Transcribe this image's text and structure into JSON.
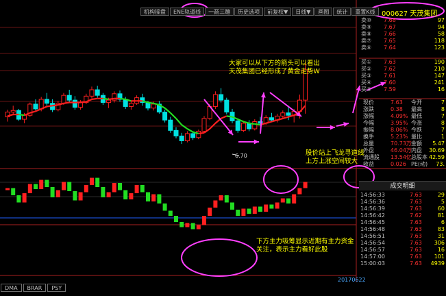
{
  "toolbar": [
    "机构操盘",
    "ENE轨道线",
    "一箭三雕",
    "历史选项",
    "前复权▼",
    "日线▼",
    "画图",
    "统计",
    "重置K线"
  ],
  "stock_title": "000627  天茂集团",
  "sell_rows": [
    [
      "卖⑩",
      "7.68",
      "97"
    ],
    [
      "卖⑨",
      "7.67",
      "94"
    ],
    [
      "卖⑧",
      "7.66",
      "58"
    ],
    [
      "卖⑦",
      "7.65",
      "118"
    ],
    [
      "卖⑥",
      "7.64",
      "123"
    ]
  ],
  "buy_rows": [
    [
      "买①",
      "7.63",
      "190"
    ],
    [
      "买②",
      "7.62",
      "210"
    ],
    [
      "买③",
      "7.61",
      "147"
    ],
    [
      "买④",
      "7.60",
      "241"
    ],
    [
      "买⑤",
      "7.59",
      "16"
    ]
  ],
  "quote_rows": [
    [
      "现价",
      "7.63",
      "今开",
      "7"
    ],
    [
      "涨跌",
      "0.38",
      "最高",
      "8"
    ],
    [
      "涨幅",
      "4.09%",
      "最低",
      "7"
    ],
    [
      "今幅",
      "3.95%",
      "今涨",
      "8"
    ],
    [
      "振幅",
      "8.06%",
      "今跌",
      "7"
    ],
    [
      "换手",
      "5.23%",
      "量比",
      "1"
    ],
    [
      "总量",
      "70.73万",
      "金额",
      "5.47"
    ],
    [
      "外盘",
      "46.04万",
      "内盘",
      "30.69"
    ],
    [
      "流通股",
      "13.54亿",
      "总股本",
      "42.59"
    ],
    [
      "收益",
      "0.026",
      "PE(动)",
      "73."
    ]
  ],
  "trade_title": "成交明细",
  "trades": [
    [
      "14:56:33",
      "7.63",
      "29"
    ],
    [
      "14:56:36",
      "7.63",
      "5"
    ],
    [
      "14:56:39",
      "7.63",
      "60"
    ],
    [
      "14:56:42",
      "7.62",
      "81"
    ],
    [
      "14:56:45",
      "7.63",
      "6"
    ],
    [
      "14:56:48",
      "7.63",
      "83"
    ],
    [
      "14:56:51",
      "7.63",
      "31"
    ],
    [
      "14:56:54",
      "7.63",
      "306"
    ],
    [
      "14:56:57",
      "7.63",
      "16"
    ],
    [
      "14:57:00",
      "7.63",
      "101"
    ],
    [
      "15:00:03",
      "7.63",
      "4939"
    ]
  ],
  "annotations": {
    "a1": [
      "大家可以从下方的箭头可以看出",
      "天茂集团已经形成了黄金走势W"
    ],
    "a2": [
      "股价站上飞龙寻道线",
      "上方上涨空间较大"
    ],
    "a3": [
      "下方主力吸筹显示近期有主力资金",
      "关注，表示主力看好此股"
    ]
  },
  "low_label": "6.70",
  "date_label": "20170622",
  "bottom_tabs": [
    "DMA",
    "BRAR",
    "PSY"
  ],
  "colors": {
    "up": "#ff2020",
    "down": "#00e0e0",
    "ma_up": "#ff2020",
    "ma_down": "#22dd22",
    "osc_up": "#ff2020",
    "osc_down": "#22dd22",
    "vol": "#d060f0",
    "arrow": "#ff40ff",
    "circle": "#ff40ff",
    "gridline": "#8a1a1a",
    "text_yellow": "#ffff00"
  },
  "chart_data": {
    "type": "candlestick",
    "ylim": [
      6.4,
      8.3
    ],
    "candles": [
      [
        7.04,
        7.13,
        6.98,
        7.1
      ],
      [
        7.1,
        7.18,
        7.06,
        7.12
      ],
      [
        7.12,
        7.14,
        6.99,
        7.01
      ],
      [
        7.01,
        7.09,
        6.96,
        7.06
      ],
      [
        7.06,
        7.22,
        7.04,
        7.2
      ],
      [
        7.2,
        7.26,
        7.12,
        7.14
      ],
      [
        7.14,
        7.29,
        7.11,
        7.26
      ],
      [
        7.26,
        7.34,
        7.18,
        7.21
      ],
      [
        7.21,
        7.26,
        7.1,
        7.13
      ],
      [
        7.13,
        7.24,
        7.11,
        7.21
      ],
      [
        7.21,
        7.34,
        7.19,
        7.31
      ],
      [
        7.31,
        7.38,
        7.22,
        7.25
      ],
      [
        7.25,
        7.3,
        7.13,
        7.16
      ],
      [
        7.16,
        7.25,
        7.13,
        7.22
      ],
      [
        7.22,
        7.33,
        7.2,
        7.3
      ],
      [
        7.3,
        7.42,
        7.27,
        7.38
      ],
      [
        7.38,
        7.43,
        7.28,
        7.31
      ],
      [
        7.31,
        7.34,
        7.19,
        7.22
      ],
      [
        7.22,
        7.28,
        7.15,
        7.25
      ],
      [
        7.25,
        7.36,
        7.22,
        7.33
      ],
      [
        7.33,
        7.37,
        7.23,
        7.26
      ],
      [
        7.26,
        7.29,
        7.14,
        7.17
      ],
      [
        7.17,
        7.24,
        7.13,
        7.21
      ],
      [
        7.21,
        7.31,
        7.19,
        7.28
      ],
      [
        7.28,
        7.33,
        7.18,
        7.22
      ],
      [
        7.22,
        7.24,
        7.12,
        7.15
      ],
      [
        7.15,
        7.23,
        7.12,
        7.2
      ],
      [
        7.2,
        7.24,
        7.08,
        7.1
      ],
      [
        7.1,
        7.13,
        6.97,
        7.0
      ],
      [
        7.0,
        7.04,
        6.84,
        6.87
      ],
      [
        6.87,
        6.91,
        6.77,
        6.8
      ],
      [
        6.8,
        6.84,
        6.7,
        6.74
      ],
      [
        6.74,
        6.86,
        6.72,
        6.83
      ],
      [
        6.83,
        6.86,
        6.75,
        6.78
      ],
      [
        6.78,
        6.88,
        6.76,
        6.86
      ],
      [
        6.86,
        7.05,
        6.84,
        7.02
      ],
      [
        7.02,
        7.2,
        7.0,
        7.17
      ],
      [
        7.17,
        7.36,
        7.14,
        7.32
      ],
      [
        7.32,
        7.4,
        7.22,
        7.25
      ],
      [
        7.25,
        7.28,
        7.07,
        7.1
      ],
      [
        7.1,
        7.14,
        6.96,
        6.99
      ],
      [
        6.99,
        7.02,
        6.84,
        6.87
      ],
      [
        6.87,
        6.99,
        6.85,
        6.96
      ],
      [
        6.96,
        7.0,
        6.86,
        6.89
      ],
      [
        6.89,
        7.01,
        6.87,
        6.98
      ],
      [
        6.98,
        7.04,
        6.93,
        6.96
      ],
      [
        6.96,
        7.06,
        6.94,
        7.03
      ],
      [
        7.03,
        7.09,
        6.98,
        7.0
      ],
      [
        7.0,
        7.08,
        6.97,
        7.05
      ],
      [
        7.05,
        7.12,
        7.02,
        7.09
      ],
      [
        7.09,
        7.18,
        7.0,
        7.06
      ],
      [
        7.06,
        7.14,
        6.97,
        7.11
      ],
      [
        7.11,
        7.32,
        7.02,
        7.25
      ],
      [
        7.25,
        7.73,
        7.08,
        7.63
      ]
    ],
    "ma": [
      7.05,
      7.07,
      7.07,
      7.06,
      7.09,
      7.11,
      7.14,
      7.17,
      7.18,
      7.19,
      7.21,
      7.22,
      7.22,
      7.22,
      7.23,
      7.26,
      7.27,
      7.27,
      7.26,
      7.27,
      7.27,
      7.26,
      7.24,
      7.24,
      7.24,
      7.22,
      7.21,
      7.19,
      7.15,
      7.09,
      7.02,
      6.94,
      6.89,
      6.85,
      6.83,
      6.84,
      6.89,
      6.96,
      7.02,
      7.05,
      7.04,
      7.01,
      6.98,
      6.96,
      6.95,
      6.94,
      6.96,
      6.98,
      7.0,
      7.02,
      7.04,
      7.06,
      7.1,
      7.18
    ],
    "osc": [
      58,
      44,
      30,
      48,
      66,
      56,
      74,
      60,
      40,
      54,
      70,
      52,
      34,
      50,
      64,
      78,
      60,
      40,
      50,
      68,
      54,
      36,
      48,
      64,
      50,
      32,
      46,
      28,
      14,
      4,
      -8,
      -18,
      -10,
      -22,
      -14,
      4,
      20,
      34,
      44,
      30,
      16,
      4,
      18,
      8,
      22,
      12,
      26,
      18,
      30,
      38,
      28,
      46,
      58,
      70
    ],
    "volume": [
      0,
      0,
      0,
      0,
      0,
      0,
      0,
      0,
      0,
      0,
      0,
      0,
      0,
      0,
      0,
      0,
      0,
      0,
      0,
      0,
      0,
      0,
      0,
      0,
      0,
      0,
      0,
      0,
      0,
      0,
      0,
      0,
      0,
      0,
      0,
      0,
      0,
      0,
      0,
      0,
      0,
      0,
      0,
      0,
      0,
      0,
      0,
      0,
      0,
      0,
      0,
      0,
      0,
      0
    ]
  }
}
